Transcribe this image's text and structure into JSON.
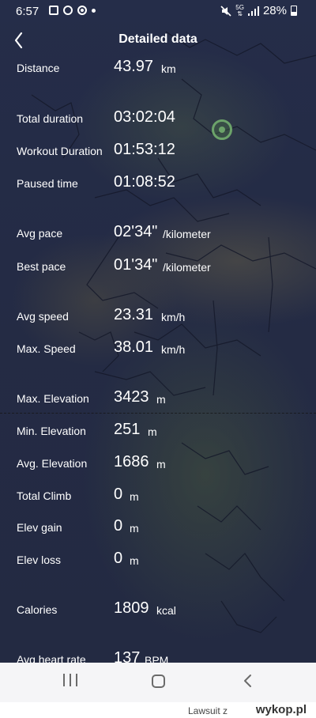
{
  "status_bar": {
    "time": "6:57",
    "network": "5G",
    "battery": "28%"
  },
  "header": {
    "title": "Detailed data"
  },
  "stats": [
    {
      "label": "Distance",
      "value": "43.97",
      "unit": "km"
    },
    {
      "label": "Total duration",
      "value": "03:02:04",
      "unit": ""
    },
    {
      "label": "Workout Duration",
      "value": "01:53:12",
      "unit": ""
    },
    {
      "label": "Paused time",
      "value": "01:08:52",
      "unit": ""
    },
    {
      "label": "Avg pace",
      "value": "02'34\"",
      "unit": "/kilometer"
    },
    {
      "label": "Best pace",
      "value": "01'34\"",
      "unit": "/kilometer"
    },
    {
      "label": "Avg speed",
      "value": "23.31",
      "unit": "km/h"
    },
    {
      "label": "Max. Speed",
      "value": "38.01",
      "unit": "km/h"
    },
    {
      "label": "Max. Elevation",
      "value": "3423",
      "unit": "m"
    },
    {
      "label": "Min. Elevation",
      "value": "251",
      "unit": "m"
    },
    {
      "label": "Avg. Elevation",
      "value": "1686",
      "unit": "m"
    },
    {
      "label": "Total Climb",
      "value": "0",
      "unit": "m"
    },
    {
      "label": "Elev gain",
      "value": "0",
      "unit": "m"
    },
    {
      "label": "Elev loss",
      "value": "0",
      "unit": "m"
    },
    {
      "label": "Calories",
      "value": "1809",
      "unit": "kcal"
    },
    {
      "label": "Avg heart rate",
      "value": "137",
      "unit": "BPM"
    }
  ],
  "watermark": {
    "user": "Lawsuit z",
    "site": "wykop.pl"
  },
  "colors": {
    "background": "#242b45",
    "text": "#ffffff",
    "marker": "#6ca36a",
    "nav_bar": "#f5f5f7"
  }
}
